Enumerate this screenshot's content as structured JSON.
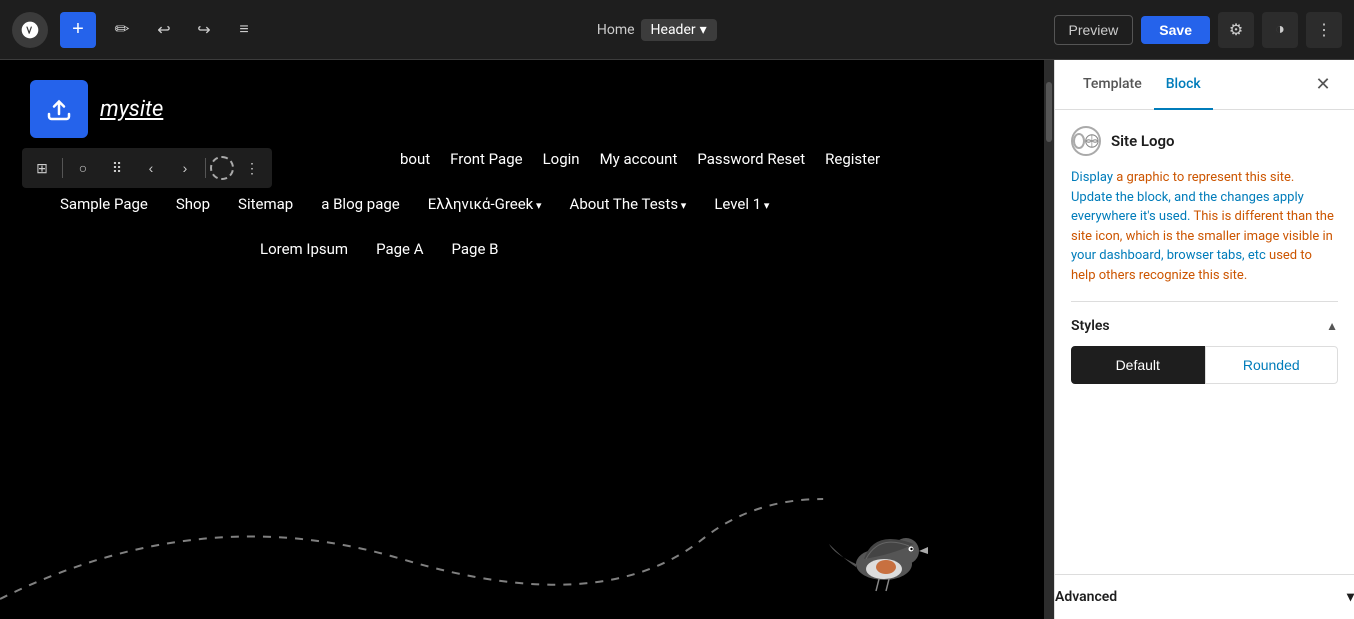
{
  "toolbar": {
    "add_label": "+",
    "pen_label": "✏",
    "undo_label": "↩",
    "redo_label": "↪",
    "list_label": "≡",
    "breadcrumb_home": "Home",
    "breadcrumb_current": "Header",
    "breadcrumb_arrow": "▾",
    "preview_label": "Preview",
    "save_label": "Save",
    "gear_label": "⚙",
    "contrast_label": "◑",
    "more_label": "⋮"
  },
  "canvas": {
    "site_name": "mysite",
    "nav_row1": [
      "bout",
      "Front Page",
      "Login",
      "My account",
      "Password Reset",
      "Register"
    ],
    "nav_row2": [
      "Sample Page",
      "Shop",
      "Sitemap",
      "a Blog page",
      "Ελληνικά-Greek",
      "About The Tests",
      "Level 1"
    ],
    "nav_row3": [
      "Lorem Ipsum",
      "Page A",
      "Page B"
    ],
    "about_tests_arrow": "▾",
    "level1_arrow": "▾",
    "greek_arrow": "▾"
  },
  "panel": {
    "tab_template": "Template",
    "tab_block": "Block",
    "close_label": "✕",
    "site_logo_title": "Site Logo",
    "site_logo_desc_part1": "Display a graphic to represent this site. Update the block, and the changes apply everywhere it's used. This is different than the site icon, which is the smaller image visible in your dashboard, browser tabs, etc used to help others recognize this site.",
    "styles_label": "Styles",
    "styles_collapse": "▲",
    "style_default": "Default",
    "style_rounded": "Rounded",
    "advanced_label": "Advanced",
    "advanced_expand": "▾"
  }
}
